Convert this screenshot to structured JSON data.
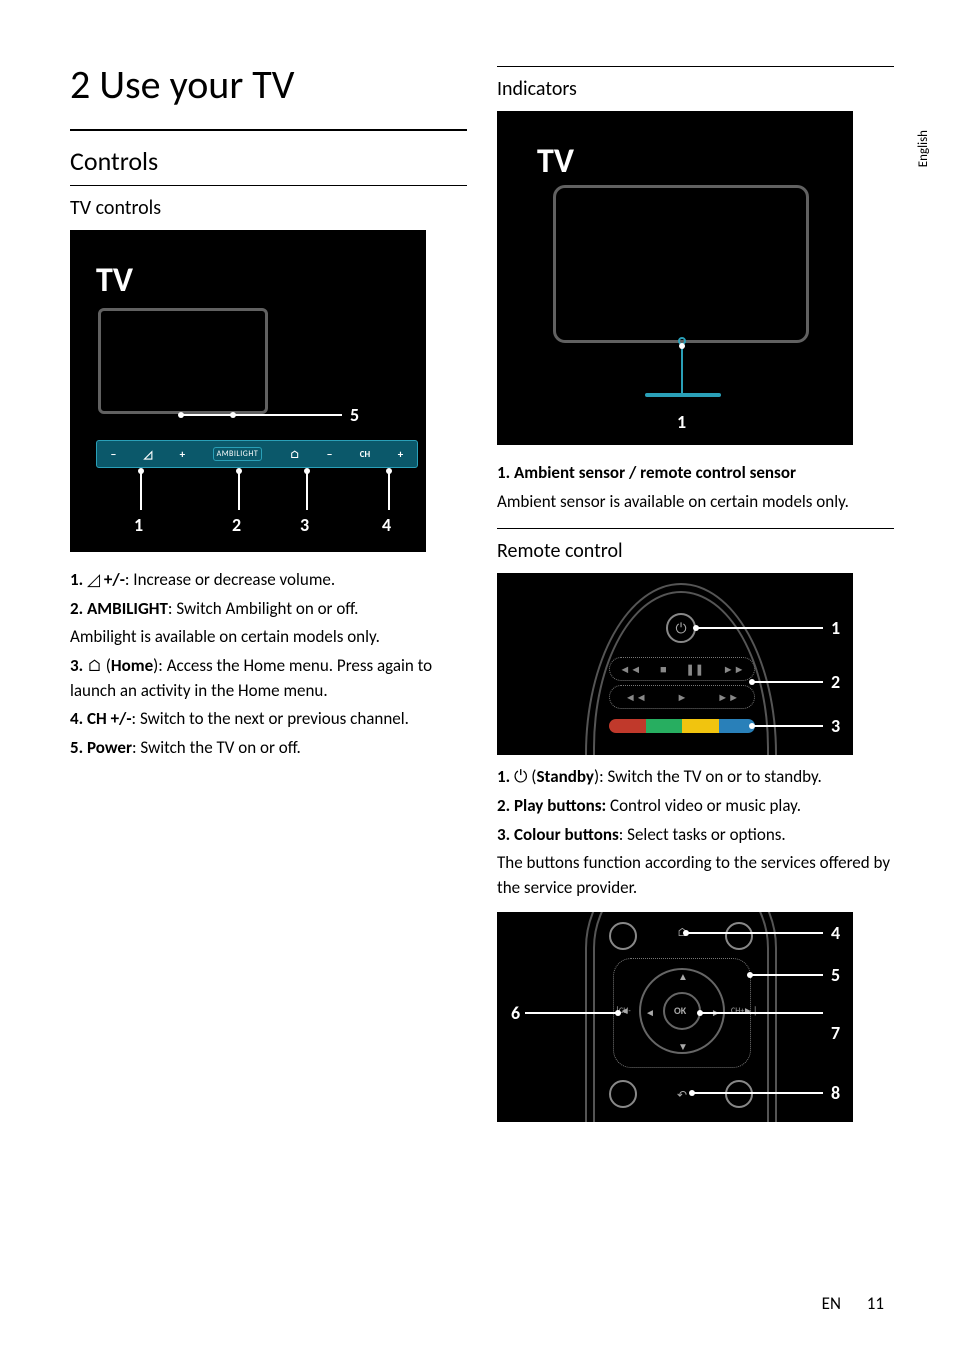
{
  "side_tab": "English",
  "chapter_title": "2  Use your TV",
  "left": {
    "section_heading": "Controls",
    "sub1": "TV controls",
    "fig1": {
      "tv_label": "TV",
      "callout5": "5",
      "callouts": [
        "1",
        "2",
        "3",
        "4"
      ],
      "ambi": "AMBILIGHT",
      "ch": "CH"
    },
    "items": [
      {
        "lead": "1. ",
        "icon": "vol",
        "bold": "+/-",
        "rest": ": Increase or decrease volume."
      },
      {
        "lead": "2. ",
        "bold": "AMBILIGHT",
        "rest": ": Switch Ambilight on or off."
      },
      {
        "lead": "",
        "bold": "",
        "rest": "Ambilight is available on certain models only."
      },
      {
        "lead": "3. ",
        "icon": "home",
        "mid": " (",
        "bold": "Home",
        "rest": "): Access the Home menu. Press again to launch an activity in the Home menu."
      },
      {
        "lead": "4. ",
        "bold": "CH +/-",
        "rest": ": Switch to the next or previous channel."
      },
      {
        "lead": "5. ",
        "bold": "Power",
        "rest": ": Switch the TV on or off."
      }
    ]
  },
  "right": {
    "sub1": "Indicators",
    "fig_ind": {
      "tv_label": "TV",
      "callout": "1"
    },
    "ind_items": [
      {
        "bold": "1. Ambient sensor / remote control sensor",
        "rest": ""
      },
      {
        "bold": "",
        "rest": "Ambient sensor is available on certain models only."
      }
    ],
    "sub2": "Remote control",
    "fig_rc1": {
      "callouts": [
        "1",
        "2",
        "3"
      ]
    },
    "rc1_items": [
      {
        "lead": "1. ",
        "icon": "power",
        "mid": " (",
        "bold": "Standby",
        "rest": "): Switch the TV on or to standby."
      },
      {
        "lead": "2. ",
        "bold": "Play buttons:",
        "rest": " Control video or music play."
      },
      {
        "lead": "3. ",
        "bold": "Colour buttons",
        "rest": ": Select tasks or options."
      },
      {
        "lead": "",
        "bold": "",
        "rest": "The buttons function according to the services offered by the service provider."
      }
    ],
    "fig_rc2": {
      "left_callout": "6",
      "right_callouts": [
        "4",
        "5",
        "7",
        "8"
      ],
      "ok": "OK",
      "chm": "CH-",
      "chp": "CH+"
    }
  },
  "footer": {
    "lang": "EN",
    "page": "11"
  }
}
